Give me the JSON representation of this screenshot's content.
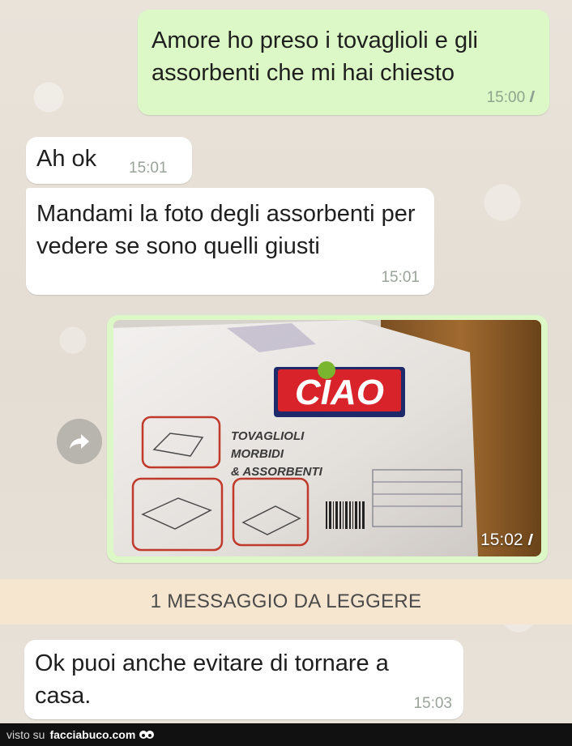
{
  "messages": [
    {
      "id": "m1",
      "direction": "outgoing",
      "text": "Amore ho preso i tovaglioli e gli assorbenti che mi hai chiesto",
      "time": "15:00",
      "ticks": "//"
    },
    {
      "id": "m2",
      "direction": "incoming",
      "text": "Ah ok",
      "time": "15:01"
    },
    {
      "id": "m3",
      "direction": "incoming",
      "text": "Mandami la foto degli assorbenti per vedere se sono quelli giusti",
      "time": "15:01"
    },
    {
      "id": "m4",
      "direction": "outgoing",
      "type": "image",
      "time": "15:02",
      "ticks": "//",
      "image": {
        "brand": "CIAO",
        "product_line1": "TOVAGLIOLI",
        "product_line2": "MORBIDI",
        "product_line3": "& ASSORBENTI"
      }
    },
    {
      "id": "m5",
      "direction": "incoming",
      "text": "Ok puoi anche evitare di tornare a casa.",
      "time": "15:03"
    }
  ],
  "unread_banner": "1 MESSAGGIO DA LEGGERE",
  "footer": {
    "visto": "visto su",
    "site": "facciabuco.com"
  },
  "icons": {
    "forward": "forward-arrow-icon",
    "ticks": "double-check-icon"
  },
  "colors": {
    "outgoing": "#dcf8c6",
    "incoming": "#ffffff",
    "banner": "#f6e6d0",
    "brand_red": "#d8232a"
  }
}
